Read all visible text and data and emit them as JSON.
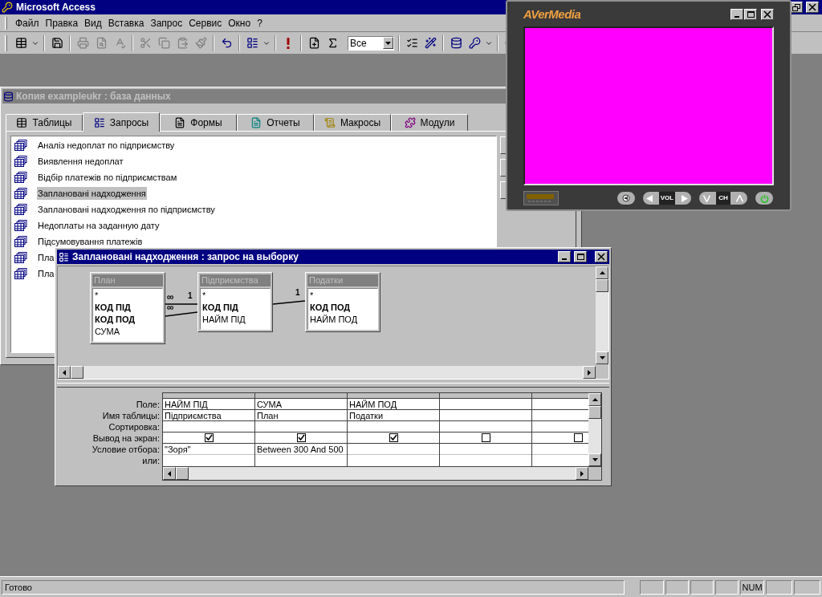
{
  "app": {
    "title": "Microsoft Access"
  },
  "menu": [
    {
      "label": "Файл"
    },
    {
      "label": "Правка"
    },
    {
      "label": "Вид"
    },
    {
      "label": "Вставка"
    },
    {
      "label": "Запрос"
    },
    {
      "label": "Сервис"
    },
    {
      "label": "Окно"
    },
    {
      "label": "?"
    }
  ],
  "toolbar": {
    "filter": "Все"
  },
  "database_window": {
    "title": "Копия exampleukr : база данных",
    "active": false,
    "tabs": [
      {
        "label": "Таблицы",
        "selected": false,
        "kind": "tables"
      },
      {
        "label": "Запросы",
        "selected": true,
        "kind": "queries"
      },
      {
        "label": "Формы",
        "selected": false,
        "kind": "forms"
      },
      {
        "label": "Отчеты",
        "selected": false,
        "kind": "reports"
      },
      {
        "label": "Макросы",
        "selected": false,
        "kind": "macros"
      },
      {
        "label": "Модули",
        "selected": false,
        "kind": "modules"
      }
    ],
    "items": [
      {
        "label": "Аналіз недоплат по підприємству",
        "selected": false
      },
      {
        "label": "Виявлення недоплат",
        "selected": false
      },
      {
        "label": "Відбір платежів по підприємствам",
        "selected": false
      },
      {
        "label": "Заплановані надходження",
        "selected": true
      },
      {
        "label": "Заплановані надходження по підприємству",
        "selected": false
      },
      {
        "label": "Недоплаты на заданную дату",
        "selected": false
      },
      {
        "label": "Підсумовування платежів",
        "selected": false
      },
      {
        "label": "Пла",
        "selected": false
      },
      {
        "label": "Пла",
        "selected": false
      }
    ]
  },
  "query_window": {
    "title": "Заплановані надходження : запрос на выборку",
    "active": true,
    "tables": [
      {
        "name": "План",
        "fields": [
          {
            "name": "*",
            "key": false
          },
          {
            "name": "КОД ПІД",
            "key": true
          },
          {
            "name": "КОД ПОД",
            "key": true
          },
          {
            "name": "СУМА",
            "key": false
          }
        ]
      },
      {
        "name": "Підприємства",
        "fields": [
          {
            "name": "*",
            "key": false
          },
          {
            "name": "КОД ПІД",
            "key": true
          },
          {
            "name": "НАЙМ ПІД",
            "key": false
          }
        ]
      },
      {
        "name": "Податки",
        "fields": [
          {
            "name": "*",
            "key": false
          },
          {
            "name": "КОД ПОД",
            "key": true
          },
          {
            "name": "НАЙМ ПОД",
            "key": false
          }
        ]
      }
    ],
    "joins": [
      {
        "many_label": "∞",
        "one_label": "1"
      },
      {
        "many_label": "∞"
      },
      {
        "one_label": "1"
      }
    ],
    "grid": {
      "row_labels": [
        "Поле:",
        "Имя таблицы:",
        "Сортировка:",
        "Вывод на экран:",
        "Условие отбора:",
        "или:"
      ],
      "columns": [
        {
          "field": "НАЙМ ПІД",
          "table": "Підприємства",
          "show": true,
          "criteria": "\"Зоря\""
        },
        {
          "field": "СУМА",
          "table": "План",
          "show": true,
          "criteria": "Between 300 And 500"
        },
        {
          "field": "НАЙМ ПОД",
          "table": "Податки",
          "show": true
        },
        {
          "show": false
        },
        {
          "show": false
        }
      ]
    }
  },
  "video_window": {
    "logo": "AVerMedia",
    "volume_label": "VOL",
    "channel_label": "CH"
  },
  "status_bar": {
    "text": "Готово",
    "indicators": [
      "NUM"
    ]
  }
}
